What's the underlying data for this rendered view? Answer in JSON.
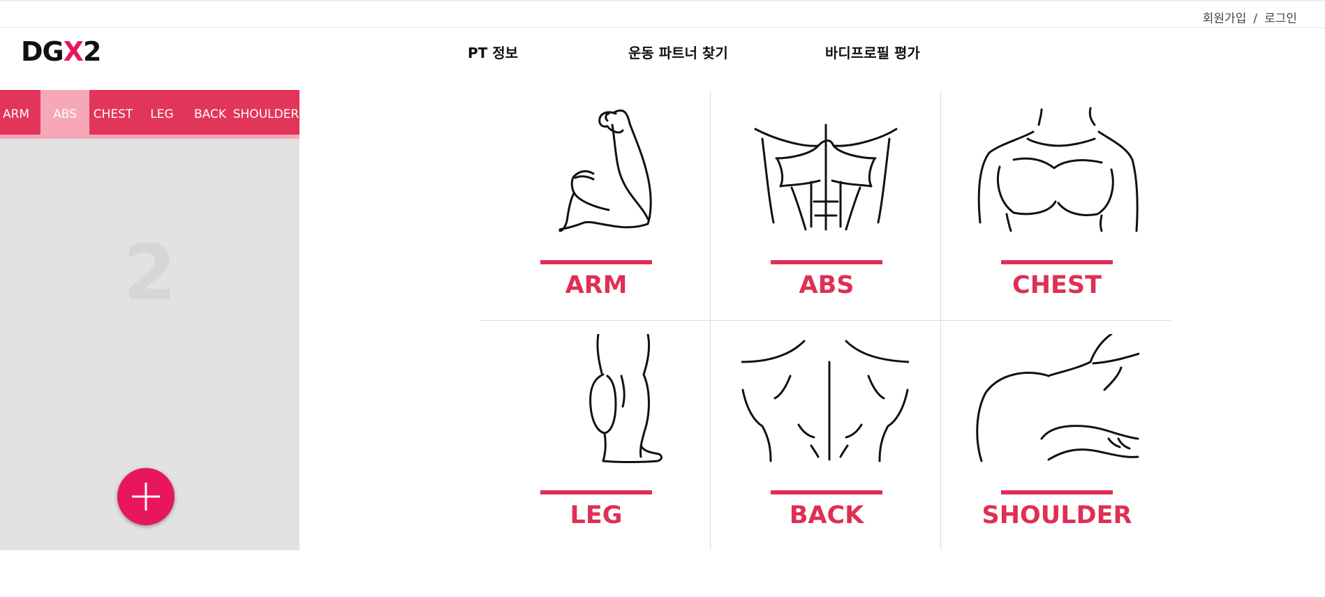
{
  "header": {
    "signup": "회원가입",
    "separator": "/",
    "login": "로그인"
  },
  "logo": {
    "part1": "DG",
    "accent": "X",
    "part2": "2",
    "accent_color": "#e8175d"
  },
  "nav": {
    "pt_info": "PT 정보",
    "find_partner": "운동 파트너 찾기",
    "body_profile": "바디프로필 평가"
  },
  "left_panel": {
    "tabs": [
      "ARM",
      "ABS",
      "CHEST",
      "LEG",
      "BACK",
      "SHOULDER"
    ],
    "active_tab": "ABS",
    "page_number": "2",
    "add_icon": "plus-icon"
  },
  "grid": {
    "items": [
      {
        "label": "ARM",
        "icon": "arm-muscle-icon"
      },
      {
        "label": "ABS",
        "icon": "abs-muscle-icon"
      },
      {
        "label": "CHEST",
        "icon": "chest-muscle-icon"
      },
      {
        "label": "LEG",
        "icon": "leg-muscle-icon"
      },
      {
        "label": "BACK",
        "icon": "back-muscle-icon"
      },
      {
        "label": "SHOULDER",
        "icon": "shoulder-muscle-icon"
      }
    ]
  },
  "colors": {
    "brand": "#e8175d",
    "tab_bg": "#e2355a",
    "tab_active": "#f7a8b8",
    "label": "#df2f55"
  }
}
